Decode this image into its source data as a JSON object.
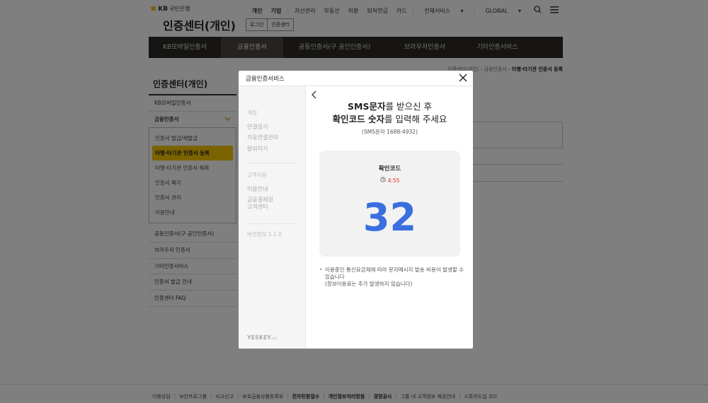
{
  "header": {
    "bank_name": "국민은행",
    "logo_mark": "KB",
    "top_nav": {
      "personal": "개인",
      "corporate": "기업",
      "items": [
        "자산관리",
        "부동산",
        "외환",
        "퇴직연금",
        "카드"
      ],
      "all_services": "전체서비스",
      "global": "GLOBAL"
    },
    "site_title": "인증센터(개인)",
    "login_button": "로그인",
    "cert_center_button": "인증센터"
  },
  "gnb": {
    "items": [
      {
        "label": "KB모바일인증서"
      },
      {
        "label": "금융인증서"
      },
      {
        "label": "공동인증서(구 공인인증서)"
      },
      {
        "label": "브라우저인증서"
      },
      {
        "label": "기타인증서비스"
      }
    ]
  },
  "breadcrumb": {
    "items": [
      "인증센터(개인)",
      "금융인증서"
    ],
    "current": "타행·타기관 인증서 등록"
  },
  "lnb": {
    "title": "인증센터(개인)",
    "mobile_cert": "KB모바일인증서",
    "financial_cert": "금융인증서",
    "sub_items": [
      {
        "label": "인증서 발급/재발급"
      },
      {
        "label": "타행·타기관 인증서 등록"
      },
      {
        "label": "타행·타기관 인증서 해제"
      },
      {
        "label": "인증서 폐기"
      },
      {
        "label": "인증서 관리"
      },
      {
        "label": "이용안내"
      }
    ],
    "other_items": [
      {
        "label": "공동인증서(구 공인인증서)"
      },
      {
        "label": "브라우저 인증서"
      },
      {
        "label": "기타인증서비스"
      },
      {
        "label": "인증서 발급 안내"
      },
      {
        "label": "인증센터 FAQ"
      }
    ]
  },
  "footer": {
    "links": [
      {
        "label": "이용상담",
        "bold": false
      },
      {
        "label": "보안프로그램",
        "bold": false
      },
      {
        "label": "사고신고",
        "bold": false
      },
      {
        "label": "보호금융상품등록부",
        "bold": false
      },
      {
        "label": "전자민원접수",
        "bold": true
      },
      {
        "label": "개인정보처리방침",
        "bold": true
      },
      {
        "label": "경영공시",
        "bold": true
      },
      {
        "label": "그룹 내 고객정보 제공안내",
        "bold": false
      },
      {
        "label": "스튜어드십 코드",
        "bold": false
      }
    ]
  },
  "modal": {
    "title": "금융인증서비스",
    "sidebar": {
      "group_settings": "계정",
      "link_device": "연결끊기",
      "auto_connect": "자동연결관리",
      "withdraw": "탈퇴하기",
      "group_support": "고객지원",
      "usage_guide": "이용안내",
      "settlement_center_line1": "금융결제원",
      "settlement_center_line2": "고객센터",
      "version": "버전정보 1.1.0",
      "logo": "YESKEY",
      "logo_small": "cert"
    },
    "headline": {
      "line1_bold": "SMS문자",
      "line1_rest": "를 받으신 후",
      "line2_bold": "확인코드 숫자",
      "line2_rest": "를 입력해 주세요"
    },
    "sms_sender": "(SMS문자 1688-4932)",
    "code_card": {
      "label": "확인코드",
      "timer": "4:55",
      "code": "32"
    },
    "notice": {
      "line1": "이용중인 통신요금제에 따라 문자메시지 발송 비용이 발생할 수 있습니다",
      "line2": "(정보이용료는 추가 발생하지 않습니다)"
    }
  },
  "colors": {
    "gnb_bg": "#2d2a26",
    "accent_yellow": "#f6c800",
    "code_blue": "#3a6fe0",
    "timer_red": "#d9362b"
  }
}
